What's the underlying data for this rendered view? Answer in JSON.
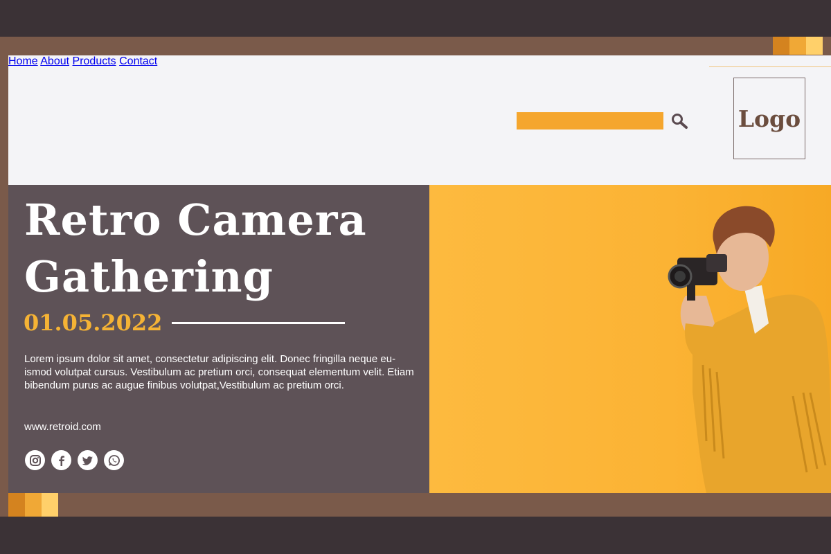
{
  "nav": {
    "items": [
      {
        "label": "Home"
      },
      {
        "label": "About"
      },
      {
        "label": "Products"
      },
      {
        "label": "Contact"
      }
    ],
    "search_placeholder": ""
  },
  "logo": {
    "text": "Logo"
  },
  "hero": {
    "title_line1": "Retro Camera",
    "title_line2": "Gathering",
    "date": "01.05.2022",
    "description": "Lorem ipsum dolor sit amet, consectetur adipiscing elit. Donec fringilla neque eu-ismod volutpat cursus. Vestibulum ac pretium orci, consequat elementum velit. Etiam bibendum purus ac augue finibus volutpat,Vestibulum ac pretium orci.",
    "website": "www.retroid.com"
  },
  "socials": [
    {
      "icon": "instagram-icon"
    },
    {
      "icon": "facebook-icon"
    },
    {
      "icon": "twitter-icon"
    },
    {
      "icon": "whatsapp-icon"
    }
  ],
  "colors": {
    "background": "#3b3236",
    "frame": "#7a5a4a",
    "panel": "#5e5257",
    "accent": "#f5a62e",
    "date": "#f5b335"
  }
}
